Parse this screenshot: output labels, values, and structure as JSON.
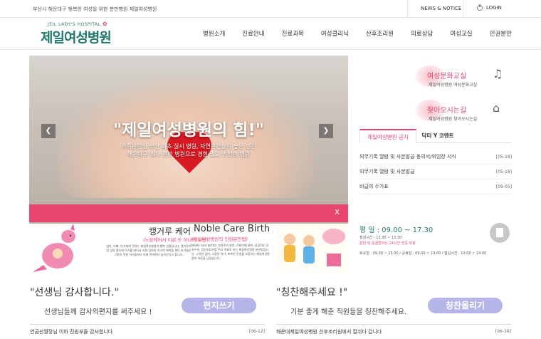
{
  "topbar": {
    "slogan": "부산시 해운대구 행복한 여성을 위한 분만병원 제일여성병원",
    "news": "NEWS & NOTICE",
    "login": "LOGIN"
  },
  "logo": {
    "en": "JEIL LADY'S HOSPITAL",
    "ko": "제일여성병원"
  },
  "nav": [
    "병원소개",
    "진료안내",
    "진료과목",
    "여성클리닉",
    "산후조리원",
    "의료상담",
    "여성교실",
    "인권분만"
  ],
  "hero": {
    "headline": "\"제일여성병원의 힘!\"",
    "sub1": "가족분만실 부산 최초 실시 병원, 자연분만율이 높은 병원",
    "sub2": "해운대구 최다 분만 병원으로 경험 많고 안전한 병원",
    "close": "X"
  },
  "side_links": [
    {
      "title": "여성문화교실",
      "desc": "제일여성병원 여성문화교실"
    },
    {
      "title": "찾아오시는길",
      "desc": "제일여성병원 찾아오시는길"
    }
  ],
  "tabs": [
    "제일여성병원 공지",
    "닥터 Y 코멘트"
  ],
  "notices": [
    {
      "title": "의무기록 열람 및 사본발급 동의서/위임장 서식",
      "date": "[05-18]"
    },
    {
      "title": "의무기록 열람 및 사본발급",
      "date": "[05-18]"
    },
    {
      "title": "비급여 수가표",
      "date": "[09-05]"
    }
  ],
  "care": {
    "title": "캥거루 케어",
    "sub": "(노블케어서 이룬 또 하나의 사랑)",
    "body": "엄마, 아빠, 아기에게 전하는 제일여성병원의 행복 선물입니다. 캥거루처럼 엄마 품속에 아기를 넣어서 키워 엄마와 아기의 애착을 쌓은 아기들은 그렇지 못한 아기들보다 미래 면역력이 높아진다고 합니다."
  },
  "noble": {
    "title": "Noble Care Birth",
    "sub": "(제일여성병원의 인권분만법)",
    "body": "Noble care birth는 자연주의 분만, 르봐이예 분만, 성공적인 모유수유, 임산부요가를 주요 목표로 하는 제일여성병원 분만법입니다. 고귀한 엄마, 소중한 아기, 축복된 탄생을 조합하는 제일여성병원의 마음을 담았습니다."
  },
  "hours": {
    "main": "평    일 : 09.00 ~ 17.30",
    "l1": "점심시간 : 12.30 ~ 13.30",
    "l2": "분만 및 응급환자는 24시간 연중 무휴",
    "l3": "토요일 : 09.00 ~ 15.00 / 공휴일 : 09.00 ~ 13.00 / 점심시간 : 13.00 ~ 14.00"
  },
  "letters": [
    {
      "quote": "\"선생님 감사합니다.\"",
      "desc": "선생님들께 감사의편지를 써주세요 !",
      "button": "편지쓰기"
    },
    {
      "quote": "\"칭찬해주세요 !\"",
      "desc": "기분 좋게 해준 직원들을 칭찬해주세요.",
      "button": "칭찬올리기"
    }
  ],
  "footer_items": [
    {
      "title": "연금선월장님 이하 진원부들 감사합니다",
      "date": "[06-12]"
    },
    {
      "title": "해운대제일여성병원 산후조리원에서 잘쉬다 갑니다",
      "date": "[06-16]"
    }
  ],
  "colors": {
    "brand": "#1f7a6c",
    "accent": "#e9466e",
    "button": "#b6b5ea"
  }
}
